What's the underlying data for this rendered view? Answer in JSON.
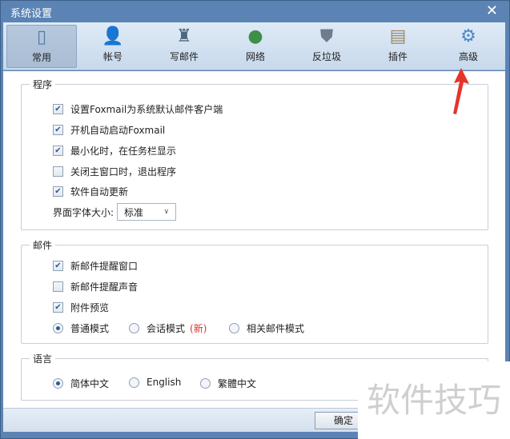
{
  "window": {
    "title": "系统设置",
    "close_icon": "close-icon"
  },
  "tabs": [
    {
      "label": "常用",
      "icon": "switch-icon",
      "active": true
    },
    {
      "label": "帐号",
      "icon": "user-icon"
    },
    {
      "label": "写邮件",
      "icon": "ink-bottle-icon"
    },
    {
      "label": "网络",
      "icon": "globe-icon"
    },
    {
      "label": "反垃圾",
      "icon": "shield-icon"
    },
    {
      "label": "插件",
      "icon": "box-icon"
    },
    {
      "label": "高级",
      "icon": "gear-icon"
    }
  ],
  "program": {
    "title": "程序",
    "options": [
      {
        "label": "设置Foxmail为系统默认邮件客户端",
        "checked": true
      },
      {
        "label": "开机自动启动Foxmail",
        "checked": true
      },
      {
        "label": "最小化时，在任务栏显示",
        "checked": true
      },
      {
        "label": "关闭主窗口时，退出程序",
        "checked": false
      },
      {
        "label": "软件自动更新",
        "checked": true
      }
    ],
    "font_size_label": "界面字体大小:",
    "font_size_value": "标准"
  },
  "mail": {
    "title": "邮件",
    "options": [
      {
        "label": "新邮件提醒窗口",
        "checked": true
      },
      {
        "label": "新邮件提醒声音",
        "checked": false
      },
      {
        "label": "附件预览",
        "checked": true
      }
    ],
    "modes": [
      {
        "label": "普通模式",
        "selected": true
      },
      {
        "label": "会话模式",
        "badge": "(新)"
      },
      {
        "label": "相关邮件模式"
      }
    ],
    "badge_color": "#d9342b"
  },
  "language": {
    "title": "语言",
    "options": [
      {
        "label": "简体中文",
        "selected": true
      },
      {
        "label": "English"
      },
      {
        "label": "繁體中文"
      }
    ]
  },
  "footer": {
    "ok_label": "确定"
  },
  "watermark": "软件技巧",
  "annotation_arrow_color": "#e8332a"
}
